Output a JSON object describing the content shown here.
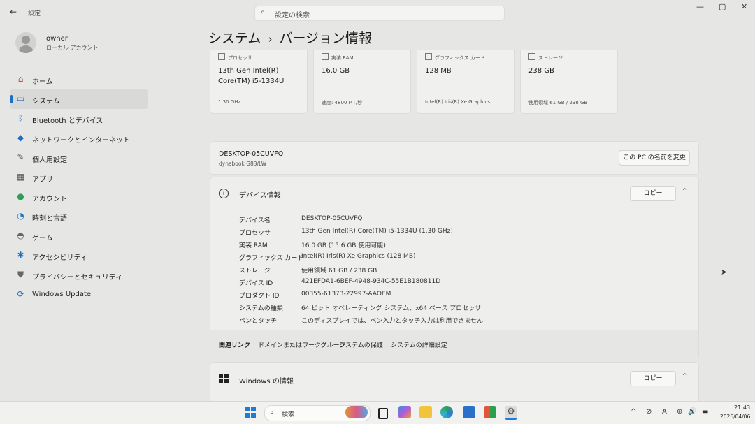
{
  "titlebar": {
    "back": "←",
    "title": "設定",
    "search_placeholder": "設定の検索",
    "minimize": "—",
    "maximize": "▢",
    "close": "✕"
  },
  "user": {
    "name": "owner",
    "account": "ローカル アカウント"
  },
  "nav": {
    "items": [
      {
        "label": "ホーム",
        "icon": "home-icon",
        "glyph": "⌂",
        "color": "#c0504d"
      },
      {
        "label": "システム",
        "icon": "system-icon",
        "glyph": "▭",
        "color": "#1f6fc0"
      },
      {
        "label": "Bluetooth とデバイス",
        "icon": "bluetooth-icon",
        "glyph": "ᛒ",
        "color": "#1f6fc0"
      },
      {
        "label": "ネットワークとインターネット",
        "icon": "network-icon",
        "glyph": "◆",
        "color": "#1f6fc0"
      },
      {
        "label": "個人用設定",
        "icon": "personalization-icon",
        "glyph": "✎",
        "color": "#555555"
      },
      {
        "label": "アプリ",
        "icon": "apps-icon",
        "glyph": "▦",
        "color": "#555555"
      },
      {
        "label": "アカウント",
        "icon": "account-icon",
        "glyph": "●",
        "color": "#2e9e5b"
      },
      {
        "label": "時刻と言語",
        "icon": "time-language-icon",
        "glyph": "◔",
        "color": "#1f6fc0"
      },
      {
        "label": "ゲーム",
        "icon": "gaming-icon",
        "glyph": "◓",
        "color": "#666666"
      },
      {
        "label": "アクセシビリティ",
        "icon": "accessibility-icon",
        "glyph": "✱",
        "color": "#1f6fc0"
      },
      {
        "label": "プライバシーとセキュリティ",
        "icon": "privacy-shield-icon",
        "glyph": "⛊",
        "color": "#666666"
      },
      {
        "label": "Windows Update",
        "icon": "windows-update-icon",
        "glyph": "⟳",
        "color": "#1f6fc0"
      }
    ],
    "active_index": 1
  },
  "page": {
    "parent": "システム",
    "separator": "›",
    "title": "バージョン情報"
  },
  "spec_cards": [
    {
      "header": "プロセッサ",
      "value": "13th Gen Intel(R) Core(TM) i5-1334U",
      "detail": "1.30 GHz"
    },
    {
      "header": "実装 RAM",
      "value": "16.0 GB",
      "detail": "速度: 4800 MT/秒"
    },
    {
      "header": "グラフィックス カード",
      "value": "128 MB",
      "detail": "Intel(R) Iris(R) Xe Graphics"
    },
    {
      "header": "ストレージ",
      "value": "238 GB",
      "detail": "使用領域 61 GB / 238 GB"
    }
  ],
  "device": {
    "name": "DESKTOP-05CUVFQ",
    "model": "dynabook G83/LW",
    "rename_label": "この PC の名前を変更"
  },
  "device_info": {
    "title": "デバイス情報",
    "copy_label": "コピー",
    "chevron": "^",
    "rows": [
      {
        "label": "デバイス名",
        "value": "DESKTOP-05CUVFQ"
      },
      {
        "label": "プロセッサ",
        "value": "13th Gen Intel(R) Core(TM) i5-1334U (1.30 GHz)"
      },
      {
        "label": "実装 RAM",
        "value": "16.0 GB (15.6 GB 使用可能)"
      },
      {
        "label": "グラフィックス カード",
        "value": "Intel(R) Iris(R) Xe Graphics (128 MB)"
      },
      {
        "label": "ストレージ",
        "value": "使用領域 61 GB / 238 GB"
      },
      {
        "label": "デバイス ID",
        "value": "421EFDA1-6BEF-4948-934C-55E1B180811D"
      },
      {
        "label": "プロダクト ID",
        "value": "00355-61373-22997-AAOEM"
      },
      {
        "label": "システムの種類",
        "value": "64 ビット オペレーティング システム、x64 ベース プロセッサ"
      },
      {
        "label": "ペンとタッチ",
        "value": "このディスプレイでは、ペン入力とタッチ入力は利用できません"
      }
    ]
  },
  "related_links": [
    "関連リンク",
    "ドメインまたはワークグループ",
    "システムの保護",
    "システムの詳細設定"
  ],
  "windows_info": {
    "title": "Windows の情報",
    "copy_label": "コピー",
    "chevron": "^"
  },
  "taskbar": {
    "search_placeholder": "検索",
    "apps": [
      "start-button",
      "widgets",
      "task-view",
      "copilot",
      "file-explorer",
      "edge",
      "store",
      "microsoft-365",
      "settings"
    ],
    "tray": [
      "^",
      "⊘",
      "A",
      "⊕",
      "🔊",
      "▬"
    ],
    "time": "21:43",
    "date": "2026/04/06"
  }
}
